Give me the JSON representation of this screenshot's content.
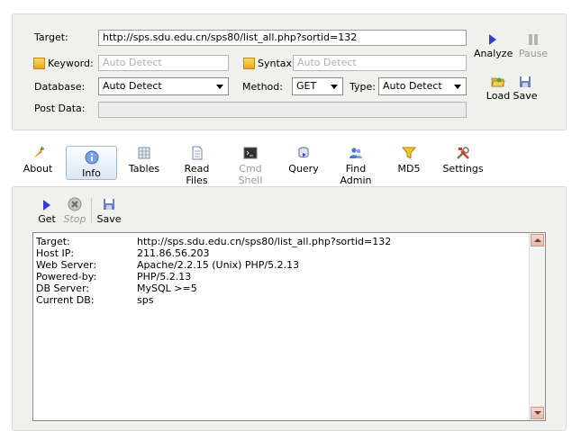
{
  "form": {
    "target_label": "Target:",
    "target_value": "http://sps.sdu.edu.cn/sps80/list_all.php?sortid=132",
    "keyword_label": "Keyword:",
    "keyword_placeholder": "Auto Detect",
    "syntax_label": "Syntax:",
    "syntax_placeholder": "Auto Detect",
    "database_label": "Database:",
    "database_value": "Auto Detect",
    "method_label": "Method:",
    "method_value": "GET",
    "type_label": "Type:",
    "type_value": "Auto Detect",
    "postdata_label": "Post Data:",
    "postdata_value": ""
  },
  "actions": {
    "analyze": "Analyze",
    "pause": "Pause",
    "load": "Load",
    "save": "Save"
  },
  "tabs": [
    {
      "label": "About"
    },
    {
      "label": "Info"
    },
    {
      "label": "Tables"
    },
    {
      "label": "Read Files"
    },
    {
      "label": "Cmd Shell"
    },
    {
      "label": "Query"
    },
    {
      "label": "Find Admin"
    },
    {
      "label": "MD5"
    },
    {
      "label": "Settings"
    }
  ],
  "subtoolbar": {
    "get": "Get",
    "stop": "Stop",
    "save": "Save"
  },
  "output": {
    "rows": [
      {
        "key": "Target:",
        "value": "http://sps.sdu.edu.cn/sps80/list_all.php?sortid=132"
      },
      {
        "key": "Host IP:",
        "value": "211.86.56.203"
      },
      {
        "key": "Web Server:",
        "value": "Apache/2.2.15 (Unix) PHP/5.2.13"
      },
      {
        "key": "Powered-by:",
        "value": "PHP/5.2.13"
      },
      {
        "key": "DB Server:",
        "value": "MySQL >=5"
      },
      {
        "key": "Current DB:",
        "value": "sps"
      }
    ]
  },
  "colors": {
    "panel": "#f0f0ed",
    "checkbox": "#f0b020",
    "play": "#3a3ac8",
    "scroll_button": "#e4b8aa"
  }
}
